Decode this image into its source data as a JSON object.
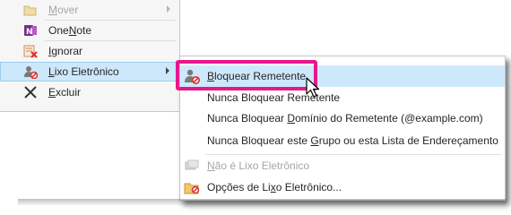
{
  "main_menu": {
    "items": [
      {
        "id": "mover",
        "label": "Mover",
        "accel": "M",
        "icon": "folder-move-icon",
        "disabled": true,
        "submenu": true
      },
      {
        "id": "onenote",
        "label": "OneNote",
        "accel": "N",
        "icon": "onenote-icon",
        "disabled": false
      },
      {
        "id": "ignorar",
        "label": "Ignorar",
        "accel": "I",
        "icon": "ignore-icon",
        "disabled": false
      },
      {
        "id": "lixo",
        "label": "Lixo Eletrônico",
        "accel": "L",
        "icon": "junk-mail-icon",
        "disabled": false,
        "submenu": true,
        "highlighted": true
      },
      {
        "id": "excluir",
        "label": "Excluir",
        "accel": "E",
        "icon": "delete-x-icon",
        "disabled": false
      }
    ]
  },
  "submenu": {
    "items": [
      {
        "id": "bloquear",
        "label": "Bloquear Remetente",
        "icon": "block-sender-icon",
        "highlighted": true
      },
      {
        "id": "nunca_bloquear",
        "label": "Nunca Bloquear Remetente"
      },
      {
        "id": "nunca_dominio",
        "label": "Nunca Bloquear Domínio do Remetente (@example.com)"
      },
      {
        "id": "nunca_grupo",
        "label": "Nunca Bloquear este Grupo ou esta Lista de Endereçamento"
      },
      {
        "id": "nao_lixo",
        "label": "Não é Lixo Eletrônico",
        "icon": "not-junk-icon",
        "disabled": true
      },
      {
        "id": "opcoes",
        "label": "Opções de Lixo Eletrônico...",
        "icon": "junk-options-icon"
      }
    ]
  },
  "colors": {
    "highlight_bg": "#cde8fb",
    "callout_border": "#e8168b",
    "disabled_text": "#a6a6a6"
  }
}
